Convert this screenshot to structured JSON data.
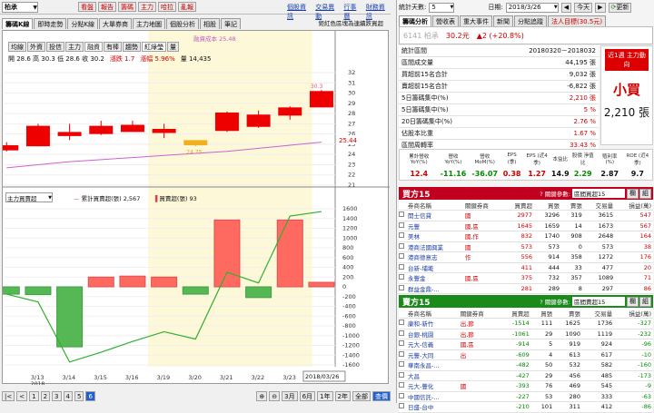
{
  "top_left": {
    "code": "6141",
    "name": "柏承",
    "buttons": [
      "看盤",
      "報告",
      "籌碼",
      "主力",
      "哈拉",
      "亂報"
    ],
    "links": [
      "個股資訊",
      "交易異動",
      "行事曆",
      "財務資訊"
    ]
  },
  "chart": {
    "tabs": [
      "籌碼K線",
      "即時走勢",
      "分點K線",
      "大單券商",
      "主力地圖",
      "個股分析",
      "相股",
      "筆記"
    ],
    "note": "鉅紅色區塊為連續跌買超",
    "ma_label": "融資成本 25.48",
    "indicator_tabs": [
      "均線",
      "外資",
      "投信",
      "主力",
      "融資",
      "有棒",
      "趨勢",
      "紅綠瑩",
      "量"
    ],
    "ohlc": "開 28.6 高 30.3 低 28.6 收 30.2",
    "change": "漲跌 1.7",
    "amp": "漲幅 5.96%",
    "volume": "量 14,435",
    "price_flag": "30.3",
    "low_flag": "24.75",
    "last_price": "25.44",
    "lower_select": "主力買賣超",
    "lower_legend1": "累計買賣超(張) 2,567",
    "lower_legend2": "買賣超(張) 93",
    "date_label": "2018/03/26",
    "y_ticks_upper": [
      "32",
      "31",
      "30",
      "29",
      "28",
      "27",
      "26",
      "25",
      "24",
      "23",
      "22",
      "21"
    ],
    "y_ticks_lower": [
      "1600",
      "1400",
      "1200",
      "1000",
      "800",
      "600",
      "400",
      "200",
      "0",
      "-200",
      "-400",
      "-600",
      "-800",
      "-1000",
      "-1200",
      "-1400",
      "-1600"
    ],
    "pager": [
      "1",
      "2",
      "3",
      "4",
      "5",
      "6"
    ],
    "zoom": [
      "3月",
      "6月",
      "1年",
      "2年",
      "全部",
      "查價"
    ],
    "x_dates": [
      "3/13",
      "3/14",
      "3/15",
      "3/16",
      "3/19",
      "3/20",
      "3/21",
      "3/22",
      "3/23"
    ],
    "x_year": "2018"
  },
  "chart_data": {
    "type": "candlestick+bar",
    "upper": {
      "dates": [
        "3/12",
        "3/13",
        "3/14",
        "3/15",
        "3/16",
        "3/19",
        "3/20",
        "3/21",
        "3/22",
        "3/23",
        "3/26"
      ],
      "candles": [
        [
          24.4,
          25.2,
          24.9,
          24.3
        ],
        [
          24.8,
          27.0,
          26.8,
          24.8
        ],
        [
          25.8,
          27.0,
          26.2,
          25.4
        ],
        [
          26.0,
          27.3,
          26.8,
          25.9
        ],
        [
          26.2,
          27.3,
          26.9,
          26.2
        ],
        [
          26.5,
          27.0,
          26.1,
          25.6
        ],
        [
          25.4,
          25.4,
          24.9,
          24.8
        ],
        [
          26.3,
          28.2,
          28.1,
          26.2
        ],
        [
          26.7,
          28.3,
          27.9,
          26.6
        ],
        [
          27.8,
          28.7,
          28.6,
          27.4
        ],
        [
          28.6,
          30.3,
          30.2,
          28.6
        ]
      ],
      "ma": [
        22.7,
        23.0,
        23.3,
        23.5,
        23.7,
        23.9,
        24.1,
        24.3,
        24.6,
        24.9,
        25.2
      ],
      "ylim": [
        21,
        32
      ]
    },
    "lower": {
      "bars": [
        -150,
        -160,
        -1230,
        200,
        220,
        200,
        -150,
        1370,
        -220,
        1370,
        93
      ],
      "cum": [
        -150,
        -310,
        -1540,
        -1340,
        -1120,
        -920,
        -1070,
        300,
        80,
        1450,
        1543
      ],
      "ylim": [
        -1600,
        1600
      ]
    }
  },
  "right": {
    "header_label": "統計天數:",
    "header_val": "5",
    "date_label": "日期:",
    "date_val": "2018/3/26",
    "today": "今天",
    "refresh": "更新",
    "tabs": [
      "籌碼分析",
      "營收表",
      "重大事件",
      "新聞",
      "分點追蹤",
      "法人目標(30.5元)"
    ],
    "stock": "6141 柏承",
    "price": "30.2元",
    "chg": "▲2 (+20.8%)",
    "stats": [
      [
        "統計區間",
        "20180320－2018032"
      ],
      [
        "區間成交量",
        "44,195 張"
      ],
      [
        "買超前15名合計",
        "9,032 張"
      ],
      [
        "賣超前15名合計",
        "-6,822 張"
      ],
      [
        "5日籌碼集中(%)",
        "2,210 張"
      ],
      [
        "5日籌碼集中(%)",
        "5 %"
      ],
      [
        "20日籌碼集中(%)",
        "2.76 %"
      ],
      [
        "佔股本比重",
        "1.67 %"
      ],
      [
        "區間周轉率",
        "33.43 %"
      ]
    ],
    "box_title": "近1週 主力動向",
    "box_main": "小買",
    "box_val": "2,210 張",
    "fund_headers": [
      "累計營收 YoY(%)",
      "營收 YoY(%)",
      "營收 MoM(%)",
      "EPS (季)",
      "EPS (近4季)",
      "本益比",
      "股價 淨值比",
      "殖利率 (%)",
      "ROE (近4季)"
    ],
    "fund_vals": [
      "12.4",
      "-11.16",
      "-36.07",
      "0.38",
      "1.27",
      "14.9",
      "2.29",
      "2.87",
      "9.7"
    ],
    "buy_title": "買方15",
    "sell_title": "賣方15",
    "sel_label": "? 關鍵參數:",
    "sel_val": "區間買超15",
    "sel_val2": "區間賣超15",
    "btn1": "欄",
    "btn2": "組",
    "cols": [
      "券商名稱",
      "關鍵券商",
      "買賣超",
      "買張",
      "賣張",
      "交易量",
      "損益(萬)"
    ],
    "buy_rows": [
      [
        "開士信貸",
        "國",
        "2977",
        "3296",
        "319",
        "3615",
        "547"
      ],
      [
        "元豐",
        "國,區",
        "1645",
        "1659",
        "14",
        "1673",
        "567"
      ],
      [
        "美林",
        "國,作",
        "832",
        "1740",
        "908",
        "2648",
        "164"
      ],
      [
        "港商法國興業",
        "國",
        "573",
        "573",
        "0",
        "573",
        "38"
      ],
      [
        "港商德意志",
        "作",
        "556",
        "914",
        "358",
        "1272",
        "176"
      ],
      [
        "台新-埔墘",
        "",
        "411",
        "444",
        "33",
        "477",
        "20"
      ],
      [
        "永豐金",
        "國,區",
        "375",
        "732",
        "357",
        "1089",
        "71"
      ],
      [
        "群益金鼎-...",
        "",
        "281",
        "289",
        "8",
        "297",
        "86"
      ],
      [
        "凱基-城東",
        "國",
        "264",
        "288",
        "24",
        "312",
        "84"
      ]
    ],
    "sell_rows": [
      [
        "康和-新竹",
        "出,節",
        "-1514",
        "111",
        "1625",
        "1736",
        "-327"
      ],
      [
        "台銀-桃園",
        "出,節",
        "-1061",
        "29",
        "1090",
        "1119",
        "-232"
      ],
      [
        "元大-信義",
        "國,區",
        "-914",
        "5",
        "919",
        "924",
        "-96"
      ],
      [
        "元豐-大同",
        "出",
        "-609",
        "4",
        "613",
        "617",
        "-10"
      ],
      [
        "華南永昌-...",
        "",
        "-482",
        "50",
        "532",
        "582",
        "-160"
      ],
      [
        "大昌",
        "",
        "-427",
        "29",
        "456",
        "485",
        "-173"
      ],
      [
        "元大-豐化",
        "國",
        "-393",
        "76",
        "469",
        "545",
        "-9"
      ],
      [
        "中國信託-...",
        "",
        "-227",
        "53",
        "280",
        "333",
        "-63"
      ],
      [
        "日盛-台中",
        "",
        "-210",
        "101",
        "311",
        "412",
        "-86"
      ]
    ]
  }
}
